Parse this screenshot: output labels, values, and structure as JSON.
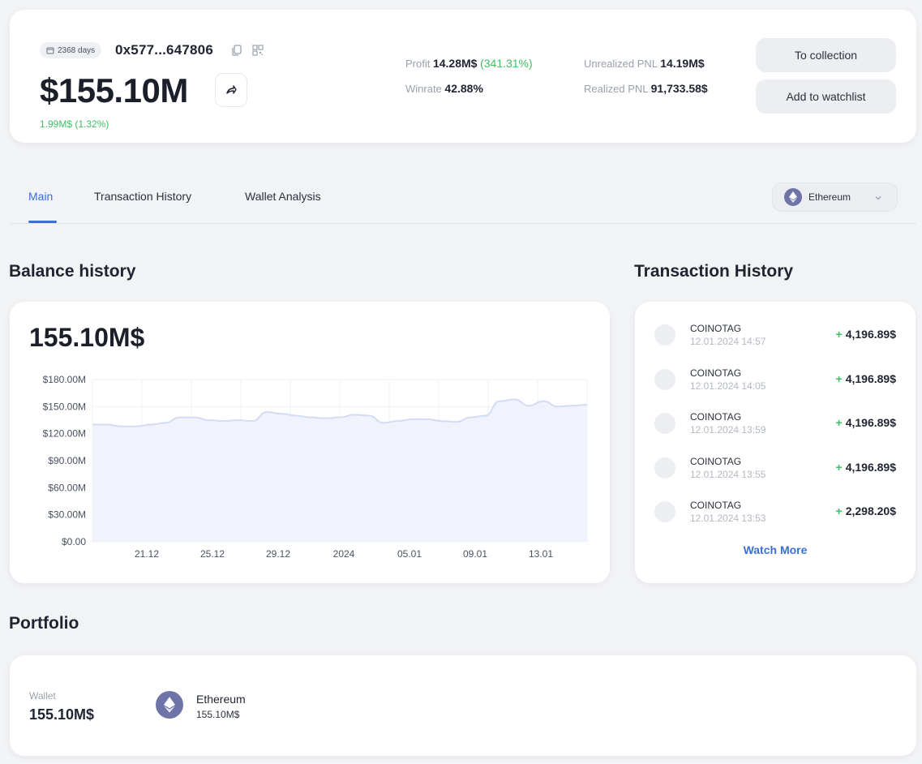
{
  "header": {
    "days_badge": "2368 days",
    "address": "0x577...647806",
    "balance": "$155.10M",
    "change": "1.99M$ (1.32%)",
    "profit_label": "Profit",
    "profit_value": "14.28M$",
    "profit_pct": "(341.31%)",
    "winrate_label": "Winrate",
    "winrate_value": "42.88%",
    "unrealized_label": "Unrealized PNL",
    "unrealized_value": "14.19M$",
    "realized_label": "Realized PNL",
    "realized_value": "91,733.58$",
    "to_collection": "To collection",
    "add_watchlist": "Add to watchlist"
  },
  "tabs": [
    {
      "label": "Main",
      "active": true
    },
    {
      "label": "Transaction History",
      "active": false
    },
    {
      "label": "Wallet Analysis",
      "active": false
    }
  ],
  "network_select": {
    "selected": "Ethereum",
    "icon": "ethereum-icon"
  },
  "balance_history": {
    "heading": "Balance history",
    "value": "155.10M$"
  },
  "chart_data": {
    "type": "area",
    "x_ticks": [
      "21.12",
      "25.12",
      "29.12",
      "2024",
      "05.01",
      "09.01",
      "13.01"
    ],
    "y_ticks": [
      "$0.00",
      "$30.00M",
      "$60.00M",
      "$90.00M",
      "$120.00M",
      "$150.00M",
      "$180.00M"
    ],
    "ylim": [
      0,
      180
    ],
    "series": [
      {
        "values": [
          130,
          130,
          128,
          128,
          130,
          132,
          138,
          138,
          135,
          134,
          135,
          134,
          144,
          142,
          140,
          138,
          137,
          138,
          141,
          140,
          132,
          134,
          136,
          136,
          134,
          133,
          138,
          140,
          156,
          158,
          151,
          156,
          150,
          151,
          152
        ]
      }
    ],
    "grid": true,
    "fill_color": "#eef1fb",
    "line_color": "#d3dbf5"
  },
  "transactions": {
    "heading": "Transaction History",
    "items": [
      {
        "name": "COINOTAG",
        "time": "12.01.2024 14:57",
        "amount": "4,196.89$"
      },
      {
        "name": "COINOTAG",
        "time": "12.01.2024 14:05",
        "amount": "4,196.89$"
      },
      {
        "name": "COINOTAG",
        "time": "12.01.2024 13:59",
        "amount": "4,196.89$"
      },
      {
        "name": "COINOTAG",
        "time": "12.01.2024 13:55",
        "amount": "4,196.89$"
      },
      {
        "name": "COINOTAG",
        "time": "12.01.2024 13:53",
        "amount": "2,298.20$"
      }
    ],
    "plus_sign": "+",
    "watch_more": "Watch More"
  },
  "portfolio": {
    "heading": "Portfolio",
    "wallet_label": "Wallet",
    "wallet_value": "155.10M$",
    "asset_name": "Ethereum",
    "asset_value": "155.10M$"
  },
  "colors": {
    "accent": "#3a6fd8",
    "positive": "#3fbf63",
    "eth": "#6e74a8"
  }
}
